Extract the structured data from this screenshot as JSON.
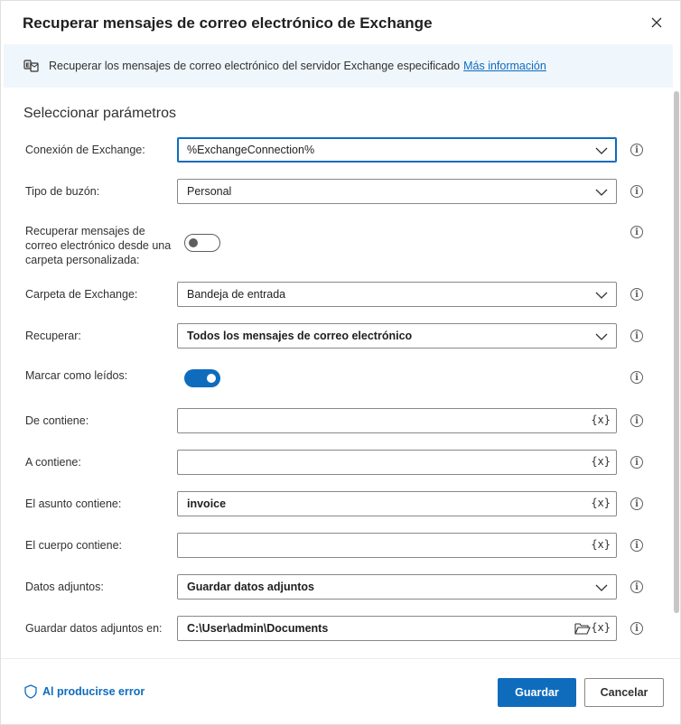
{
  "dialog": {
    "title": "Recuperar mensajes de correo electrónico de Exchange",
    "banner_text": "Recuperar los mensajes de correo electrónico del servidor Exchange especificado",
    "banner_link": "Más información",
    "section_title": "Seleccionar parámetros"
  },
  "fields": {
    "connection": {
      "label": "Conexión de Exchange:",
      "value": "%ExchangeConnection%"
    },
    "mailbox": {
      "label": "Tipo de buzón:",
      "value": "Personal"
    },
    "custom_folder": {
      "label": "Recuperar mensajes de correo electrónico desde una carpeta personalizada:",
      "enabled": false
    },
    "folder": {
      "label": "Carpeta de Exchange:",
      "value": "Bandeja de entrada"
    },
    "retrieve": {
      "label": "Recuperar:",
      "value": "Todos los mensajes de correo electrónico"
    },
    "mark_read": {
      "label": "Marcar como leídos:",
      "enabled": true
    },
    "from": {
      "label": "De contiene:",
      "value": ""
    },
    "to": {
      "label": "A contiene:",
      "value": ""
    },
    "subject": {
      "label": "El asunto contiene:",
      "value": "invoice"
    },
    "body": {
      "label": "El cuerpo contiene:",
      "value": ""
    },
    "attachments": {
      "label": "Datos adjuntos:",
      "value": "Guardar datos adjuntos"
    },
    "save_to": {
      "label": "Guardar datos adjuntos en:",
      "value": "C:\\User\\admin\\Documents"
    }
  },
  "var_symbol": "{x}",
  "info_symbol": "i",
  "footer": {
    "on_error": "Al producirse error",
    "save": "Guardar",
    "cancel": "Cancelar"
  },
  "colors": {
    "accent": "#0f6cbd",
    "banner_bg": "#eff6fc"
  }
}
